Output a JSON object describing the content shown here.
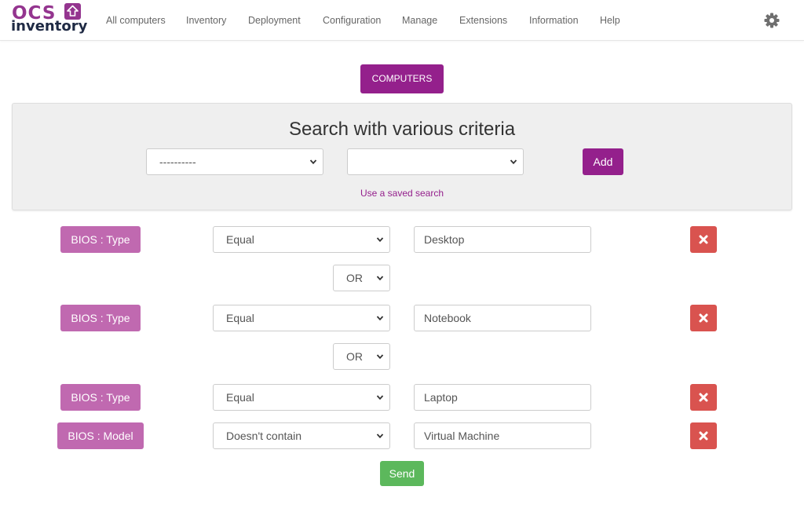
{
  "navbar": {
    "logo_top": "OCS",
    "logo_bottom": "inventory",
    "items": [
      {
        "label": "All computers"
      },
      {
        "label": "Inventory"
      },
      {
        "label": "Deployment"
      },
      {
        "label": "Configuration"
      },
      {
        "label": "Manage"
      },
      {
        "label": "Extensions"
      },
      {
        "label": "Information"
      },
      {
        "label": "Help"
      }
    ],
    "settings_icon": "gear-icon"
  },
  "computers_button": "COMPUTERS",
  "search": {
    "title": "Search with various criteria",
    "field_select_value": "----------",
    "operator_select_value": "",
    "add_label": "Add",
    "saved_search_link": "Use a saved search"
  },
  "criteria": [
    {
      "field": "BIOS : Type",
      "operator": "Equal",
      "value": "Desktop"
    },
    {
      "field": "BIOS : Type",
      "operator": "Equal",
      "value": "Notebook"
    },
    {
      "field": "BIOS : Type",
      "operator": "Equal",
      "value": "Laptop"
    },
    {
      "field": "BIOS : Model",
      "operator": "Doesn't contain",
      "value": "Virtual Machine"
    }
  ],
  "connectors": [
    "OR",
    "OR"
  ],
  "send_label": "Send",
  "colors": {
    "brand_purple": "#94208c",
    "criteria_label": "#c069b0",
    "delete_red": "#d9534f",
    "send_green": "#5cb85c",
    "panel_bg": "#efefef"
  }
}
